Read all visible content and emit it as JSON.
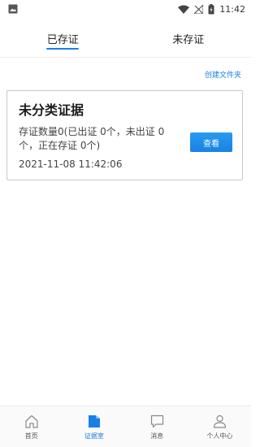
{
  "status_bar": {
    "time": "11:42"
  },
  "tabs": [
    {
      "label": "已存证",
      "active": true
    },
    {
      "label": "未存证",
      "active": false
    }
  ],
  "create_folder_label": "创建文件夹",
  "card": {
    "title": "未分类证据",
    "description": "存证数量0(已出证 0个，未出证  0个，正在存证   0个)",
    "timestamp": "2021-11-08 11:42:06",
    "view_button_label": "查看"
  },
  "bottom_nav": {
    "items": [
      {
        "label": "首页",
        "icon": "home-icon",
        "active": false
      },
      {
        "label": "证据室",
        "icon": "evidence-room-icon",
        "active": true
      },
      {
        "label": "消息",
        "icon": "message-icon",
        "active": false
      },
      {
        "label": "个人中心",
        "icon": "person-icon",
        "active": false
      }
    ]
  },
  "colors": {
    "accent": "#1a7ee8"
  }
}
